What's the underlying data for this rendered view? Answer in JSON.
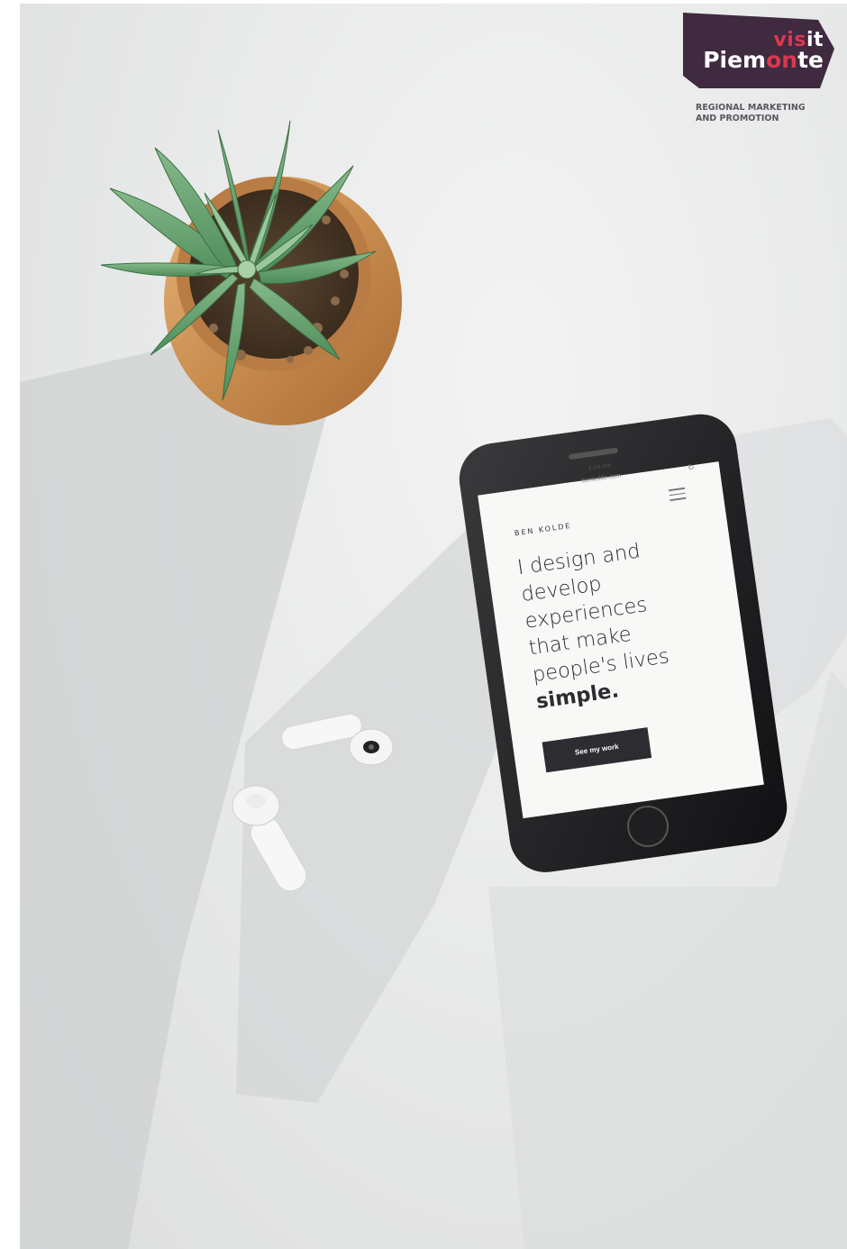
{
  "logo": {
    "visit_prefix": "vis",
    "visit_suffix": "it",
    "piemonte_start": "Piem",
    "piemonte_mid": "on",
    "piemonte_end": "te",
    "tagline_line1": "REGIONAL MARKETING",
    "tagline_line2": "AND PROMOTION",
    "badge_color": "#3f2a40",
    "accent_color": "#d9384f"
  },
  "phone": {
    "status_time": "9:54 AM",
    "url": "benkolde.com",
    "site_name": "BEN KOLDE",
    "headline_lines": [
      "I design and",
      "develop",
      "experiences",
      "that make",
      "people's lives"
    ],
    "headline_bold": "simple.",
    "cta_label": "See my work"
  },
  "icons": {
    "menu": "hamburger-menu-icon",
    "reload": "reload-icon"
  }
}
